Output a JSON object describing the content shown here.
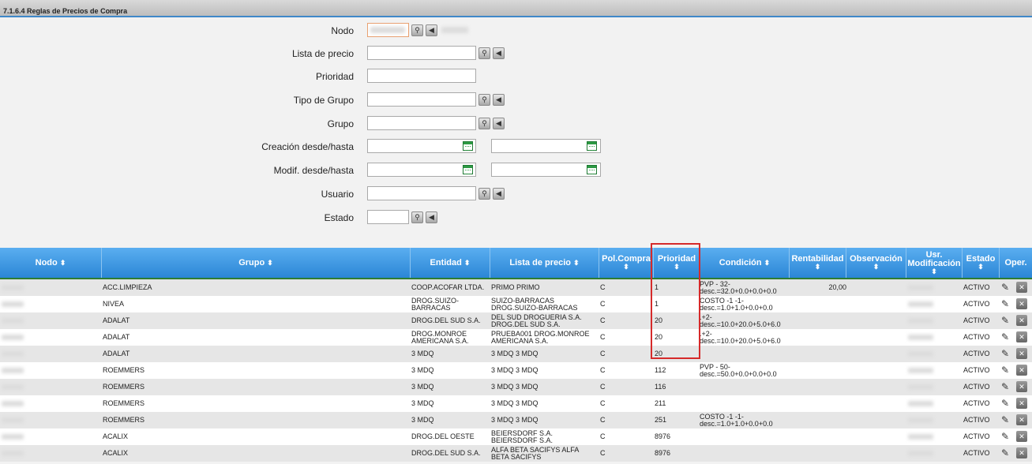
{
  "title": "7.1.6.4 Reglas de Precios de Compra",
  "form": {
    "nodo_label": "Nodo",
    "lista_label": "Lista de precio",
    "prioridad_label": "Prioridad",
    "tipo_grupo_label": "Tipo de Grupo",
    "grupo_label": "Grupo",
    "creacion_label": "Creación desde/hasta",
    "modif_label": "Modif. desde/hasta",
    "usuario_label": "Usuario",
    "estado_label": "Estado"
  },
  "columns": {
    "nodo": "Nodo",
    "grupo": "Grupo",
    "entidad": "Entidad",
    "lista": "Lista de precio",
    "pol1": "Pol.Compra",
    "prioridad": "Prioridad",
    "condicion": "Condición",
    "rentabilidad": "Rentabilidad",
    "observacion": "Observación",
    "usr1": "Usr.",
    "usr2": "Modificación",
    "estado": "Estado",
    "oper": "Oper."
  },
  "sort_glyph": "⬍",
  "rows": [
    {
      "grupo": "ACC.LIMPIEZA",
      "entidad": [
        "COOP.ACOFAR LTDA."
      ],
      "lista": [
        "PRIMO PRIMO"
      ],
      "pol": "C",
      "prioridad": "1",
      "condicion": [
        "PVP - 32-",
        "desc.=32.0+0.0+0.0+0.0"
      ],
      "rent": "20,00",
      "estado": "ACTIVO"
    },
    {
      "grupo": "NIVEA",
      "entidad": [
        "DROG.SUIZO-",
        "BARRACAS"
      ],
      "lista": [
        "SUIZO-BARRACAS",
        "DROG.SUIZO-BARRACAS"
      ],
      "pol": "C",
      "prioridad": "1",
      "condicion": [
        "COSTO -1 -1-",
        "desc.=1.0+1.0+0.0+0.0"
      ],
      "rent": "",
      "estado": "ACTIVO"
    },
    {
      "grupo": "ADALAT",
      "entidad": [
        "DROG.DEL SUD S.A."
      ],
      "lista": [
        "DEL SUD DROGUERIA S.A.",
        "DROG.DEL SUD S.A."
      ],
      "pol": "C",
      "prioridad": "20",
      "condicion": [
        ".+2-",
        "desc.=10.0+20.0+5.0+6.0"
      ],
      "rent": "",
      "estado": "ACTIVO"
    },
    {
      "grupo": "ADALAT",
      "entidad": [
        "DROG.MONROE",
        "AMERICANA S.A."
      ],
      "lista": [
        "PRUEBA001 DROG.MONROE",
        "AMERICANA S.A."
      ],
      "pol": "C",
      "prioridad": "20",
      "condicion": [
        ".+2-",
        "desc.=10.0+20.0+5.0+6.0"
      ],
      "rent": "",
      "estado": "ACTIVO"
    },
    {
      "grupo": "ADALAT",
      "entidad": [
        "3 MDQ"
      ],
      "lista": [
        "3 MDQ 3 MDQ"
      ],
      "pol": "C",
      "prioridad": "20",
      "condicion": [],
      "rent": "",
      "estado": "ACTIVO"
    },
    {
      "grupo": "ROEMMERS",
      "entidad": [
        "3 MDQ"
      ],
      "lista": [
        "3 MDQ 3 MDQ"
      ],
      "pol": "C",
      "prioridad": "112",
      "condicion": [
        "PVP - 50-",
        "desc.=50.0+0.0+0.0+0.0"
      ],
      "rent": "",
      "estado": "ACTIVO"
    },
    {
      "grupo": "ROEMMERS",
      "entidad": [
        "3 MDQ"
      ],
      "lista": [
        "3 MDQ 3 MDQ"
      ],
      "pol": "C",
      "prioridad": "116",
      "condicion": [],
      "rent": "",
      "estado": "ACTIVO"
    },
    {
      "grupo": "ROEMMERS",
      "entidad": [
        "3 MDQ"
      ],
      "lista": [
        "3 MDQ 3 MDQ"
      ],
      "pol": "C",
      "prioridad": "211",
      "condicion": [],
      "rent": "",
      "estado": "ACTIVO"
    },
    {
      "grupo": "ROEMMERS",
      "entidad": [
        "3 MDQ"
      ],
      "lista": [
        "3 MDQ 3 MDQ"
      ],
      "pol": "C",
      "prioridad": "251",
      "condicion": [
        "COSTO -1 -1-",
        "desc.=1.0+1.0+0.0+0.0"
      ],
      "rent": "",
      "estado": "ACTIVO"
    },
    {
      "grupo": "ACALIX",
      "entidad": [
        "DROG.DEL OESTE"
      ],
      "lista": [
        "BEIERSDORF S.A.",
        "BEIERSDORF S.A."
      ],
      "pol": "C",
      "prioridad": "8976",
      "condicion": [],
      "rent": "",
      "estado": "ACTIVO"
    },
    {
      "grupo": "ACALIX",
      "entidad": [
        "DROG.DEL SUD S.A."
      ],
      "lista": [
        "ALFA BETA SACIFYS ALFA",
        "BETA SACIFYS"
      ],
      "pol": "C",
      "prioridad": "8976",
      "condicion": [],
      "rent": "",
      "estado": "ACTIVO"
    }
  ]
}
